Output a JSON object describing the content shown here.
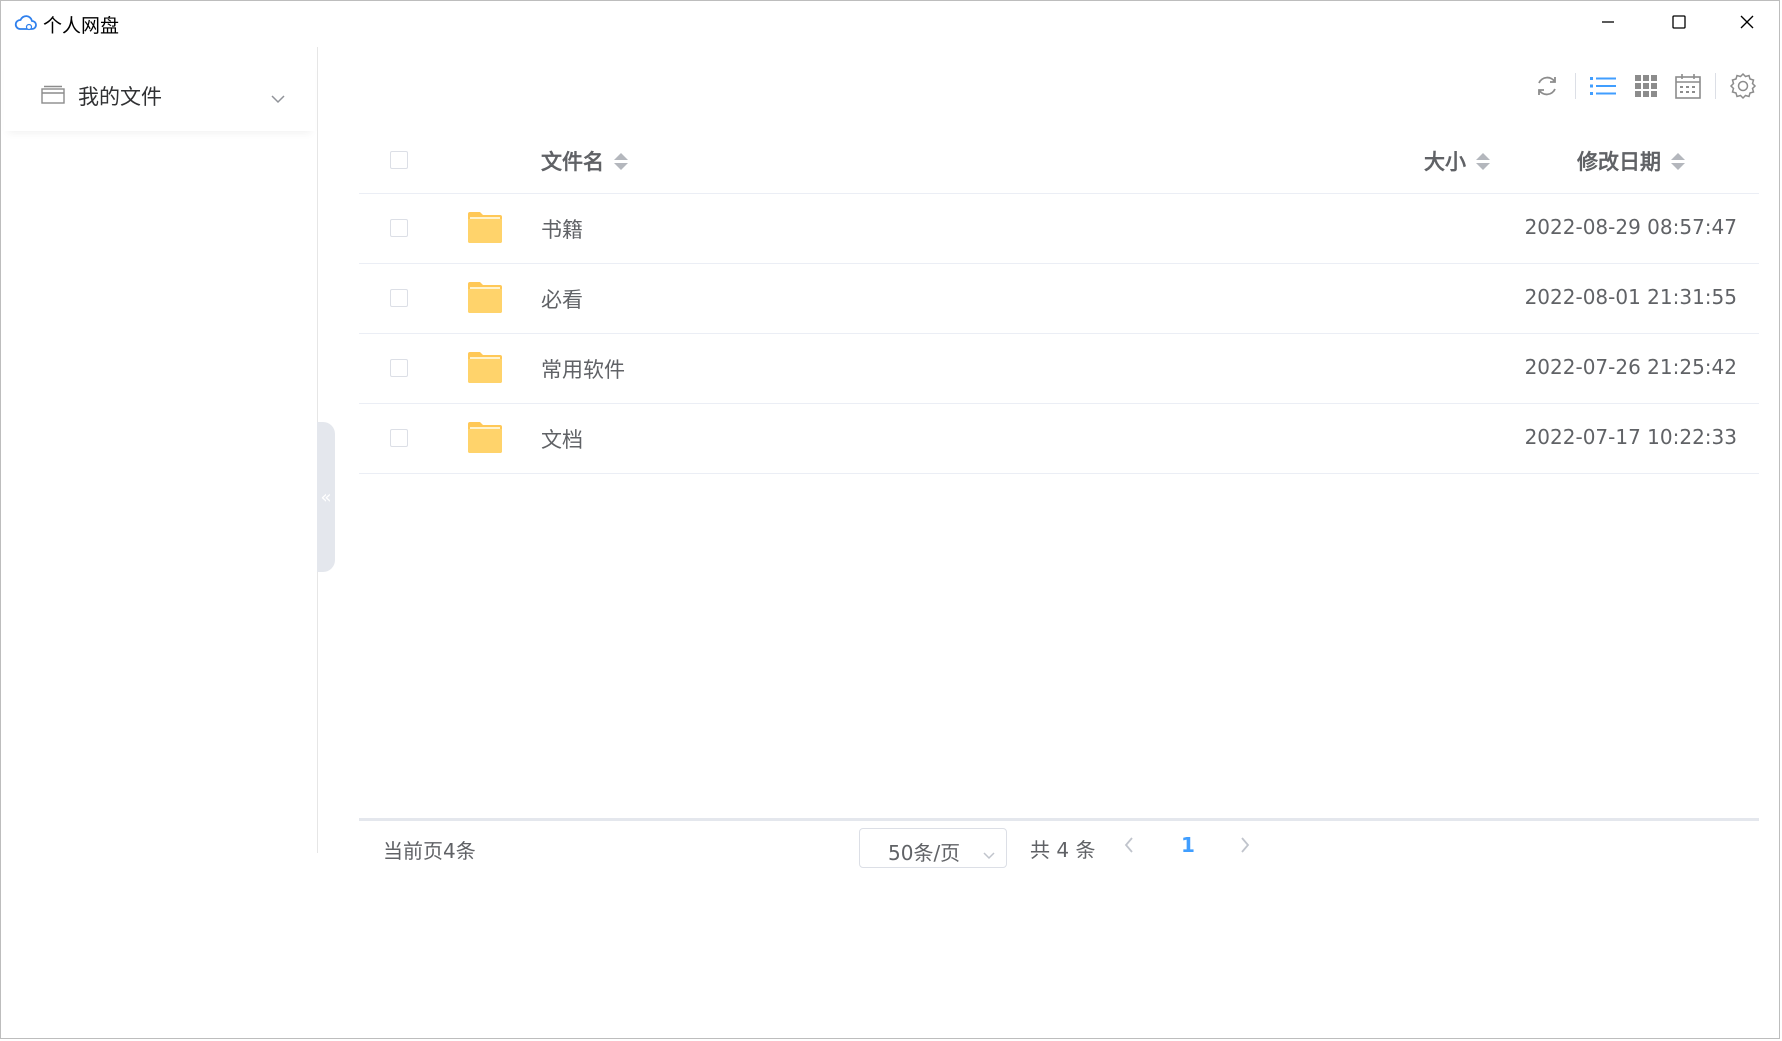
{
  "window": {
    "title": "个人网盘"
  },
  "sidebar": {
    "menu_label": "我的文件"
  },
  "toolbar": {
    "icons": [
      "refresh-icon",
      "list-view-icon",
      "grid-view-icon",
      "calendar-view-icon",
      "settings-icon"
    ],
    "active_view": "list",
    "accent_color": "#409eff"
  },
  "table": {
    "headers": {
      "name": "文件名",
      "size": "大小",
      "date": "修改日期"
    },
    "rows": [
      {
        "name": "书籍",
        "size": "",
        "date": "2022-08-29 08:57:47"
      },
      {
        "name": "必看",
        "size": "",
        "date": "2022-08-01 21:31:55"
      },
      {
        "name": "常用软件",
        "size": "",
        "date": "2022-07-26 21:25:42"
      },
      {
        "name": "文档",
        "size": "",
        "date": "2022-07-17 10:22:33"
      }
    ]
  },
  "pagination": {
    "current_count": "当前页4条",
    "page_size": "50条/页",
    "total": "共 4 条",
    "page": "1"
  }
}
